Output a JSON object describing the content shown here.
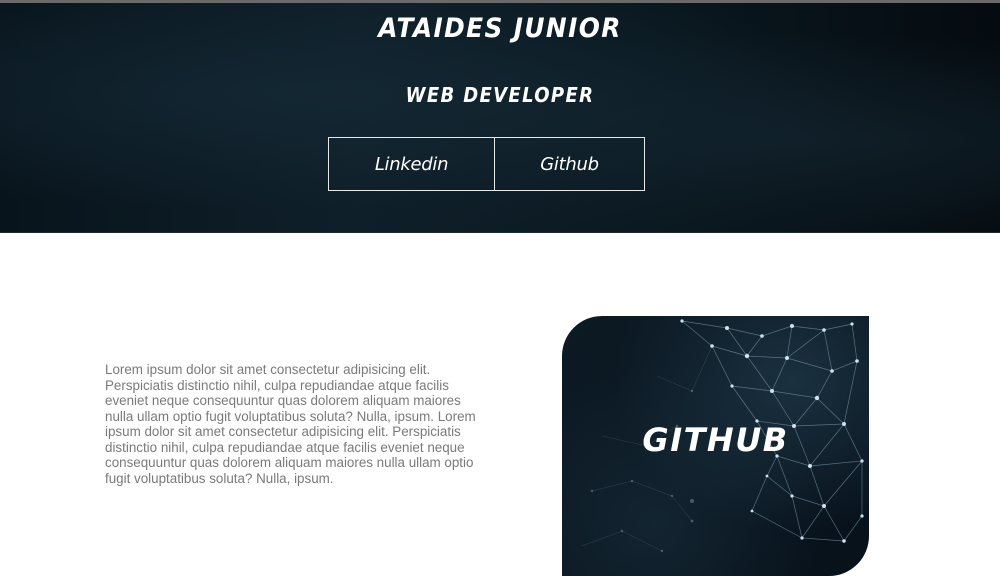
{
  "header": {
    "name": "ATAIDES JUNIOR",
    "role": "WEB DEVELOPER",
    "buttons": {
      "linkedin": "Linkedin",
      "github": "Github"
    }
  },
  "about": {
    "text": "Lorem ipsum dolor sit amet consectetur adipisicing elit. Perspiciatis distinctio nihil, culpa repudiandae atque facilis eveniet neque consequuntur quas dolorem aliquam maiores nulla ullam optio fugit voluptatibus soluta? Nulla, ipsum. Lorem ipsum dolor sit amet consectetur adipisicing elit. Perspiciatis distinctio nihil, culpa repudiandae atque facilis eveniet neque consequuntur quas dolorem aliquam maiores nulla ullam optio fugit voluptatibus soluta? Nulla, ipsum."
  },
  "card": {
    "label": "GITHUB",
    "background_icon": "network-mesh"
  },
  "colors": {
    "hero_bg": "#0a1820",
    "card_bg": "#0a1620",
    "text_light": "#ffffff",
    "body_text": "#7a7a7a",
    "network_line": "#8fb3c9"
  }
}
